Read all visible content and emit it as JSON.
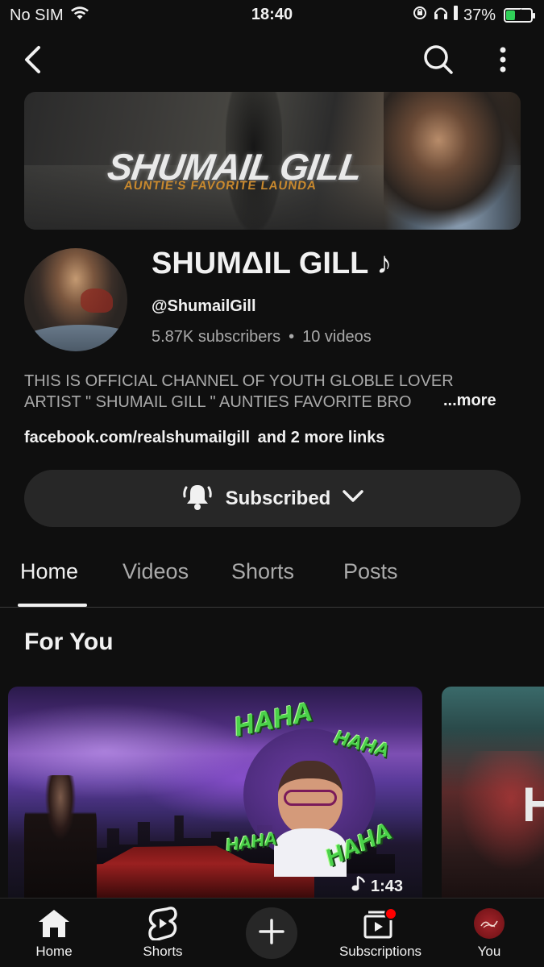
{
  "status_bar": {
    "carrier": "No SIM",
    "time": "18:40",
    "battery_percent": "37%",
    "battery_level": 0.37
  },
  "top_bar": {
    "back_icon": "back-arrow-icon",
    "search_icon": "search-icon",
    "more_icon": "more-vert-icon"
  },
  "banner": {
    "title": "SHUMAIL GILL",
    "subtitle": "AUNTIE'S FAVORITE LAUNDA"
  },
  "channel": {
    "name": "SHUMΔIL GILL ♪",
    "handle": "@ShumailGill",
    "subscribers": "5.87K subscribers",
    "separator": "•",
    "videos": "10 videos",
    "description_line1": "THIS IS OFFICIAL CHANNEL OF YOUTH GLOBLE LOVER",
    "description_line2": "ARTIST \" SHUMAIL GILL \" AUNTIES FAVORITE BRO",
    "more_label": "...more",
    "link_main": "facebook.com/realshumailgill",
    "link_more": "and 2 more links",
    "subscribe_label": "Subscribed"
  },
  "tabs": [
    {
      "label": "Home",
      "active": true
    },
    {
      "label": "Videos",
      "active": false
    },
    {
      "label": "Shorts",
      "active": false
    },
    {
      "label": "Posts",
      "active": false
    }
  ],
  "section": {
    "title": "For You"
  },
  "videos": [
    {
      "duration": "1:43",
      "overlay_text": [
        "HAHA",
        "HAHA",
        "HAHA",
        "HAHA"
      ]
    },
    {
      "overlay_text": "H"
    }
  ],
  "bottom_nav": {
    "items": [
      {
        "label": "Home",
        "icon": "home-icon"
      },
      {
        "label": "Shorts",
        "icon": "shorts-icon"
      },
      {
        "label": "",
        "icon": "create-plus-icon"
      },
      {
        "label": "Subscriptions",
        "icon": "subscriptions-icon"
      },
      {
        "label": "You",
        "icon": "you-avatar-icon"
      }
    ]
  },
  "colors": {
    "background": "#0f0f0f",
    "text": "#f1f1f1",
    "secondary_text": "#aaaaaa",
    "button_bg": "#272727",
    "battery_green": "#30d158",
    "notification_red": "#ff0000"
  }
}
